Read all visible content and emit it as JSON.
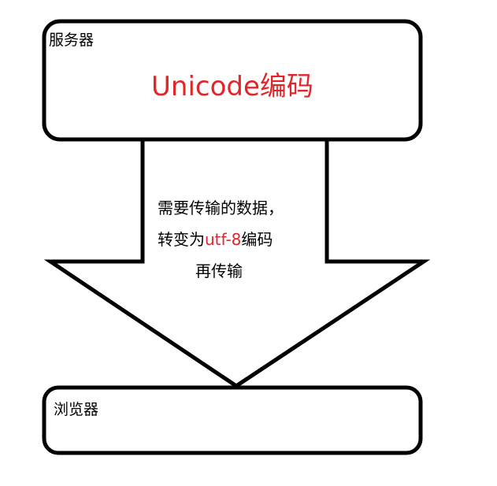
{
  "server": {
    "label": "服务器",
    "encoding": "Unicode编码"
  },
  "transfer": {
    "line1": "需要传输的数据，",
    "line2_prefix": "转变为",
    "line2_highlight": "utf-8",
    "line2_suffix": "编码",
    "line3": "再传输"
  },
  "browser": {
    "label": "浏览器"
  },
  "colors": {
    "highlight": "#e0262b",
    "stroke": "#000000",
    "background": "#ffffff"
  }
}
